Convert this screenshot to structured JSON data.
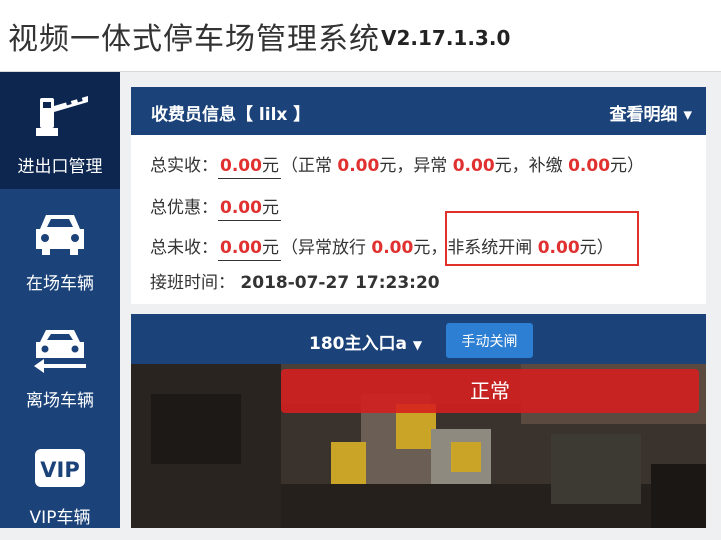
{
  "header": {
    "app_title": "视频一体式停车场管理系统",
    "version": "V2.17.1.3.0"
  },
  "sidebar": {
    "items": [
      {
        "label": "进出口管理",
        "icon": "barrier-gate-icon",
        "active": true
      },
      {
        "label": "在场车辆",
        "icon": "car-icon",
        "active": false
      },
      {
        "label": "离场车辆",
        "icon": "car-exit-icon",
        "active": false
      },
      {
        "label": "VIP车辆",
        "icon": "vip-icon",
        "active": false
      }
    ]
  },
  "cashier": {
    "title": "收费员信息【 lilx 】",
    "detail_label": "查看明细",
    "total_received_label": "总实收：",
    "total_received": "0.00",
    "normal_label": "正常",
    "normal": "0.00",
    "abnormal_label": "异常",
    "abnormal": "0.00",
    "supplement_label": "补缴",
    "supplement": "0.00",
    "total_discount_label": "总优惠：",
    "total_discount": "0.00",
    "total_uncollected_label": "总未收：",
    "total_uncollected": "0.00",
    "abnormal_release_label": "异常放行",
    "abnormal_release": "0.00",
    "non_system_open_label": "非系统开闸",
    "non_system_open": "0.00",
    "currency": "元",
    "shift_label": "接班时间：",
    "shift_time": "2018-07-27 17:23:20"
  },
  "camera": {
    "entrance_name": "180主入口a",
    "close_button_label": "手动关闸",
    "status_text": "正常"
  },
  "colors": {
    "primary": "#1b4279",
    "active": "#0c264f",
    "amount": "#e03030",
    "button": "#2d7fd3"
  }
}
